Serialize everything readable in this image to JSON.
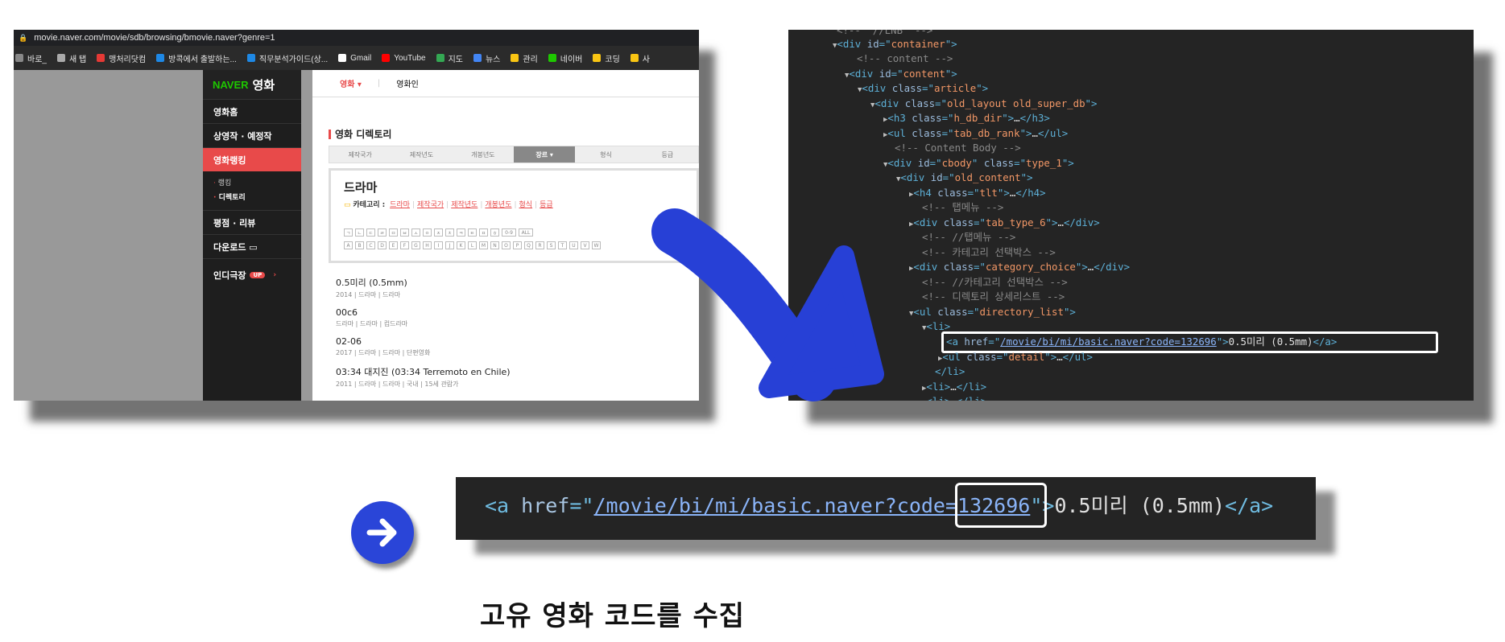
{
  "browser": {
    "url": "movie.naver.com/movie/sdb/browsing/bmovie.naver?genre=1",
    "bookmarks": [
      "바로_",
      "새 탭",
      "맹처리닷컴",
      "방콕에서 출발하는...",
      "직무분석가이드(상...",
      "Gmail",
      "YouTube",
      "지도",
      "뉴스",
      "관리",
      "네이버",
      "코딩",
      "사"
    ],
    "bookmark_colors": [
      "#888888",
      "#aaaaaa",
      "#e53935",
      "#1e88e5",
      "#1e88e5",
      "#ffffff",
      "#ff0000",
      "#34a853",
      "#4285f4",
      "#f9c513",
      "#1ec800",
      "#f9c513",
      "#f9c513"
    ]
  },
  "naver": {
    "logo_brand": "NAVER",
    "logo_title": "영화",
    "side_menu": [
      "영화홈",
      "상영작 · 예정작",
      "영화랭킹"
    ],
    "sub_menu": [
      "랭킹",
      "디렉토리"
    ],
    "side_menu2": [
      "평점 · 리뷰",
      "다운로드 ▭",
      "인디극장"
    ],
    "up_badge": "UP",
    "top_tabs": [
      "영화 ▾",
      "영화인"
    ],
    "directory_title": "영화 디렉토리",
    "filter_tabs": [
      "제작국가",
      "제작년도",
      "개봉년도",
      "장르 ▾",
      "형식",
      "등급"
    ],
    "genre_name": "드라마",
    "category_label": "카테고리 :",
    "category_links": [
      "드라마",
      "제작국가",
      "제작년도",
      "개봉년도",
      "형식",
      "등급"
    ],
    "letters_row1": [
      "ㄱ",
      "ㄴ",
      "ㄷ",
      "ㄹ",
      "ㅁ",
      "ㅂ",
      "ㅅ",
      "ㅇ",
      "ㅈ",
      "ㅊ",
      "ㅋ",
      "ㅌ",
      "ㅍ",
      "ㅎ",
      "0-9",
      "ALL"
    ],
    "letters_row2": [
      "A",
      "B",
      "C",
      "D",
      "E",
      "F",
      "G",
      "H",
      "I",
      "J",
      "K",
      "L",
      "M",
      "N",
      "O",
      "P",
      "Q",
      "R",
      "S",
      "T",
      "U",
      "V",
      "W"
    ],
    "movies": [
      {
        "title": "0.5미리 (0.5mm)",
        "meta": "2014 | 드라마 | 드라마"
      },
      {
        "title": "00c6",
        "meta": "드라마 | 드라마 | 컴드라마"
      },
      {
        "title": "02-06",
        "meta": "2017 | 드라마 | 드라마 | 단편영화"
      },
      {
        "title": "03:34 대지진 (03:34 Terremoto en Chile)",
        "meta": "2011 | 드라마 | 드라마 | 국내 | 15세 관람가"
      }
    ]
  },
  "devtools": {
    "container_id": "container",
    "content_comment": "content",
    "content_id": "content",
    "article_class": "article",
    "layout_class": "old_layout old_super_db",
    "h3_class": "h_db_dir",
    "ul_class": "tab_db_rank",
    "body_comment": "Content Body",
    "cbody_id": "cbody",
    "cbody_class": "type_1",
    "old_content_id": "old_content",
    "h4_class": "tlt",
    "tab_comment1": "탭메뉴",
    "tab_class": "tab_type_6",
    "tab_comment2": "//탭메뉴",
    "cat_comment1": "카테고리 선택박스",
    "cat_class": "category_choice",
    "cat_comment2": "//카테고리 선택박스",
    "dir_comment": "디렉토리 상세리스트",
    "dir_class": "directory_list",
    "href": "/movie/bi/mi/basic.naver?code=132696",
    "link_text": "0.5미리 (0.5mm)",
    "detail_class": "detail"
  },
  "strip": {
    "href_path": "/movie/bi/mi/basic.naver?code=",
    "code": "132696",
    "link_text": "0.5미리 (0.5mm)"
  },
  "caption": "고유 영화 코드를 수집",
  "colors": {
    "accent_blue": "#2a45d8",
    "naver_red": "#e84a4a",
    "naver_green": "#1ec800"
  }
}
